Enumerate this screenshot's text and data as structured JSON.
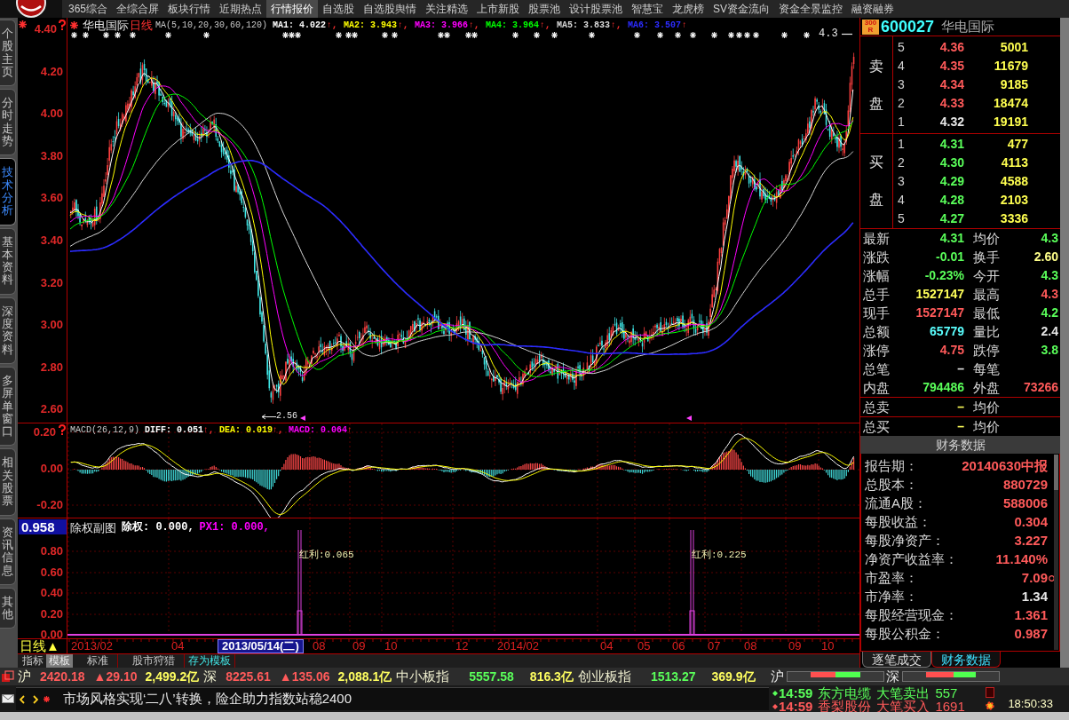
{
  "menu": {
    "items": [
      {
        "label": "365综合",
        "selected": false
      },
      {
        "label": "全综合屏",
        "selected": false
      },
      {
        "label": "板块行情",
        "selected": false
      },
      {
        "label": "近期热点",
        "selected": false
      },
      {
        "label": "行情报价",
        "selected": true
      },
      {
        "label": "自选股",
        "selected": false
      },
      {
        "label": "自选股舆情",
        "selected": false
      },
      {
        "label": "关注精选",
        "selected": false
      },
      {
        "label": "上市新股",
        "selected": false
      },
      {
        "label": "股票池",
        "selected": false
      },
      {
        "label": "设计股票池",
        "selected": false
      },
      {
        "label": "智慧宝",
        "selected": false
      },
      {
        "label": "龙虎榜",
        "selected": false
      },
      {
        "label": "SV资金流向",
        "selected": false
      },
      {
        "label": "资金全景监控",
        "selected": false
      },
      {
        "label": "融资融券",
        "selected": false
      }
    ]
  },
  "sidebar": {
    "tabs": [
      {
        "label": "个股主页",
        "selected": false
      },
      {
        "label": "分时走势",
        "selected": false
      },
      {
        "label": "技术分析",
        "selected": true
      },
      {
        "label": "基本资料",
        "selected": false
      },
      {
        "label": "深度资料",
        "selected": false
      },
      {
        "label": "多屏单窗口",
        "selected": false
      },
      {
        "label": "相关股票",
        "selected": false
      },
      {
        "label": "资讯信息",
        "selected": false
      },
      {
        "label": "其他",
        "selected": false
      }
    ]
  },
  "price_chart": {
    "stock_name": "华电国际",
    "period": "日线",
    "ma_params": "MA(5,10,20,30,60,120)",
    "ma_values": [
      {
        "label": "MA1: 4.022",
        "arrow": "↑,",
        "color": "#ffffff"
      },
      {
        "label": "MA2: 3.943",
        "arrow": "↑,",
        "color": "#ffff00"
      },
      {
        "label": "MA3: 3.966",
        "arrow": "↑,",
        "color": "#ff00ff"
      },
      {
        "label": "MA4: 3.964",
        "arrow": "↑,",
        "color": "#00ff00"
      },
      {
        "label": "MA5: 3.833",
        "arrow": "↑,",
        "color": "#d8d8d8"
      },
      {
        "label": "MA6: 3.507",
        "arrow": "↑",
        "color": "#2c2cff"
      }
    ],
    "axis_labels": [
      "4.40",
      "4.20",
      "4.00",
      "3.80",
      "3.60",
      "3.40",
      "3.20",
      "3.00",
      "2.80",
      "2.60"
    ],
    "high_label": "4.3",
    "low_label": "2.56"
  },
  "macd": {
    "title": "MACD(26,12,9)",
    "values": [
      {
        "label": "DIFF: 0.051",
        "arrow": "↑,",
        "color": "#ffffff"
      },
      {
        "label": "DEA: 0.019",
        "arrow": "↑,",
        "color": "#ffff00"
      },
      {
        "label": "MACD: 0.064",
        "arrow": "↑",
        "color": "#ff00ff"
      }
    ],
    "axis_labels": [
      "0.20",
      "0.00",
      "-0.20"
    ]
  },
  "exright": {
    "title": "除权副图",
    "values": [
      {
        "label": "除权: 0.000,",
        "color": "#ffffff"
      },
      {
        "label": "PX1: 0.000,",
        "color": "#ff00ff"
      }
    ],
    "cursor_value": "0.958",
    "axis_labels": [
      "0.80",
      "0.60",
      "0.40",
      "0.20",
      "0.00"
    ],
    "events": [
      {
        "label": "红利:0.065"
      },
      {
        "label": "红利:0.225"
      }
    ]
  },
  "date_axis": {
    "period": "日线▲",
    "ticks": [
      "2013/02",
      "04",
      "08",
      "09",
      "10",
      "12",
      "2014/02",
      "04",
      "05",
      "06",
      "07",
      "08",
      "09",
      "10"
    ],
    "cursor_date": "2013/05/14(二)"
  },
  "bottom_tabs": [
    {
      "label": "指标",
      "kind": "tab",
      "selected": false
    },
    {
      "label": "模板",
      "kind": "tab",
      "selected": true
    },
    {
      "label": "标准",
      "kind": "button",
      "selected": false
    },
    {
      "label": "股市狩猎",
      "kind": "button",
      "selected": false
    },
    {
      "label": "存为模板",
      "kind": "link",
      "selected": false
    }
  ],
  "quote": {
    "badge_lines": [
      "300",
      "R"
    ],
    "code": "600027",
    "name": "华电国际",
    "sell_label": "卖盘",
    "buy_label": "买盘",
    "asks": [
      {
        "rank": "5",
        "price": "4.36",
        "volume": "5001",
        "color": "#ff5a5a"
      },
      {
        "rank": "4",
        "price": "4.35",
        "volume": "11679",
        "color": "#ff5a5a"
      },
      {
        "rank": "3",
        "price": "4.34",
        "volume": "9185",
        "color": "#ff5a5a"
      },
      {
        "rank": "2",
        "price": "4.33",
        "volume": "18474",
        "color": "#ff5a5a"
      },
      {
        "rank": "1",
        "price": "4.32",
        "volume": "19191",
        "color": "#e6e6e6"
      }
    ],
    "bids": [
      {
        "rank": "1",
        "price": "4.31",
        "volume": "477",
        "color": "#5aff5a"
      },
      {
        "rank": "2",
        "price": "4.30",
        "volume": "4113",
        "color": "#5aff5a"
      },
      {
        "rank": "3",
        "price": "4.29",
        "volume": "4588",
        "color": "#5aff5a"
      },
      {
        "rank": "4",
        "price": "4.28",
        "volume": "2103",
        "color": "#5aff5a"
      },
      {
        "rank": "5",
        "price": "4.27",
        "volume": "3336",
        "color": "#5aff5a"
      }
    ],
    "stats": [
      {
        "left": {
          "label": "最新",
          "value": "4.31",
          "color": "#5aff5a"
        },
        "right": {
          "label": "均价",
          "value": "4.3",
          "color": "#5aff5a"
        }
      },
      {
        "left": {
          "label": "涨跌",
          "value": "-0.01",
          "color": "#5aff5a"
        },
        "right": {
          "label": "换手",
          "value": "2.60",
          "color": "#ffff8a"
        }
      },
      {
        "left": {
          "label": "涨幅",
          "value": "-0.23%",
          "color": "#5aff5a"
        },
        "right": {
          "label": "今开",
          "value": "4.3",
          "color": "#5aff5a"
        }
      },
      {
        "left": {
          "label": "总手",
          "value": "1527147",
          "color": "#ffff5a"
        },
        "right": {
          "label": "最高",
          "value": "4.3",
          "color": "#ff5a5a"
        }
      },
      {
        "left": {
          "label": "现手",
          "value": "1527147",
          "color": "#ff5a5a"
        },
        "right": {
          "label": "最低",
          "value": "4.2",
          "color": "#5aff5a"
        }
      },
      {
        "left": {
          "label": "总额",
          "value": "65779",
          "color": "#5affff"
        },
        "right": {
          "label": "量比",
          "value": "2.4",
          "color": "#e6e6e6"
        }
      },
      {
        "left": {
          "label": "涨停",
          "value": "4.75",
          "color": "#ff5a5a"
        },
        "right": {
          "label": "跌停",
          "value": "3.8",
          "color": "#5aff5a"
        }
      },
      {
        "left": {
          "label": "总笔",
          "value": "–",
          "color": "#e6e6e6"
        },
        "right": {
          "label": "每笔"
        }
      },
      {
        "left": {
          "label": "内盘",
          "value": "794486",
          "color": "#5aff5a"
        },
        "right": {
          "label": "外盘",
          "value": "73266",
          "color": "#ff5a5a"
        }
      }
    ],
    "totals": [
      {
        "left": {
          "label": "总卖",
          "value": "–",
          "color": "#ffff5a"
        },
        "right": {
          "label": "均价"
        }
      },
      {
        "left": {
          "label": "总买",
          "value": "–",
          "color": "#ffff5a"
        },
        "right": {
          "label": "均价"
        }
      }
    ]
  },
  "finance": {
    "title": "财务数据",
    "rows": [
      {
        "label": "报告期：",
        "value": "20140630中报",
        "color": "#ff5a5a",
        "kind": "plain"
      },
      {
        "label": "总股本：",
        "value": "880729",
        "color": "#ff5a5a",
        "kind": "plain"
      },
      {
        "label": "流通A股：",
        "value": "588006",
        "color": "#ff5a5a",
        "kind": "plain"
      },
      {
        "label": "每股收益：",
        "value": "0.304",
        "color": "#ff5a5a",
        "kind": "plain"
      },
      {
        "label": "每股净资产：",
        "value": "3.227",
        "color": "#ff5a5a",
        "kind": "plain"
      },
      {
        "label": "净资产收益率：",
        "value": "11.140%",
        "color": "#ff5a5a",
        "kind": "plain"
      },
      {
        "label": "市盈率：",
        "value": "7.09",
        "color": "#ff5a5a",
        "kind": "flagged"
      },
      {
        "label": "市净率：",
        "value": "1.34",
        "color": "#e6e6e6",
        "kind": "plain"
      },
      {
        "label": "每股经营现金：",
        "value": "1.361",
        "color": "#ff5a5a",
        "kind": "plain"
      },
      {
        "label": "每股公积金：",
        "value": "0.987",
        "color": "#ff5a5a",
        "kind": "plain"
      }
    ],
    "tabs": [
      {
        "label": "逐笔成交",
        "selected": false
      },
      {
        "label": "财务数据",
        "selected": true
      }
    ]
  },
  "index_ticker": [
    {
      "name": "沪",
      "value": "2420.18",
      "change": "▲29.10",
      "amount": "2,499.2亿",
      "color": "#ff5a5a"
    },
    {
      "name": "深",
      "value": "8225.61",
      "change": "▲135.06",
      "amount": "2,088.1亿",
      "color": "#ff5a5a"
    },
    {
      "name": "中小板指",
      "value": "5557.58",
      "amount": "816.3亿",
      "color": "#5aff5a"
    },
    {
      "name": "创业板指",
      "value": "1513.27",
      "amount": "369.9亿",
      "color": "#5aff5a"
    }
  ],
  "market_breadth": [
    {
      "name": "沪",
      "level": 0.5
    },
    {
      "name": "深",
      "level": 0.55
    }
  ],
  "news": {
    "headline": "市场风格实现‘二八’转换，险企助力指数站稳2400"
  },
  "alerts": [
    {
      "time": "14:59",
      "stock": "东方电缆",
      "event": "大笔卖出",
      "volume": "557",
      "color": "#5aff5a"
    },
    {
      "time": "14:59",
      "stock": "香梨股份",
      "event": "大笔买入",
      "volume": "1691",
      "color": "#ff5a5a"
    }
  ],
  "clock": "18:50:33"
}
